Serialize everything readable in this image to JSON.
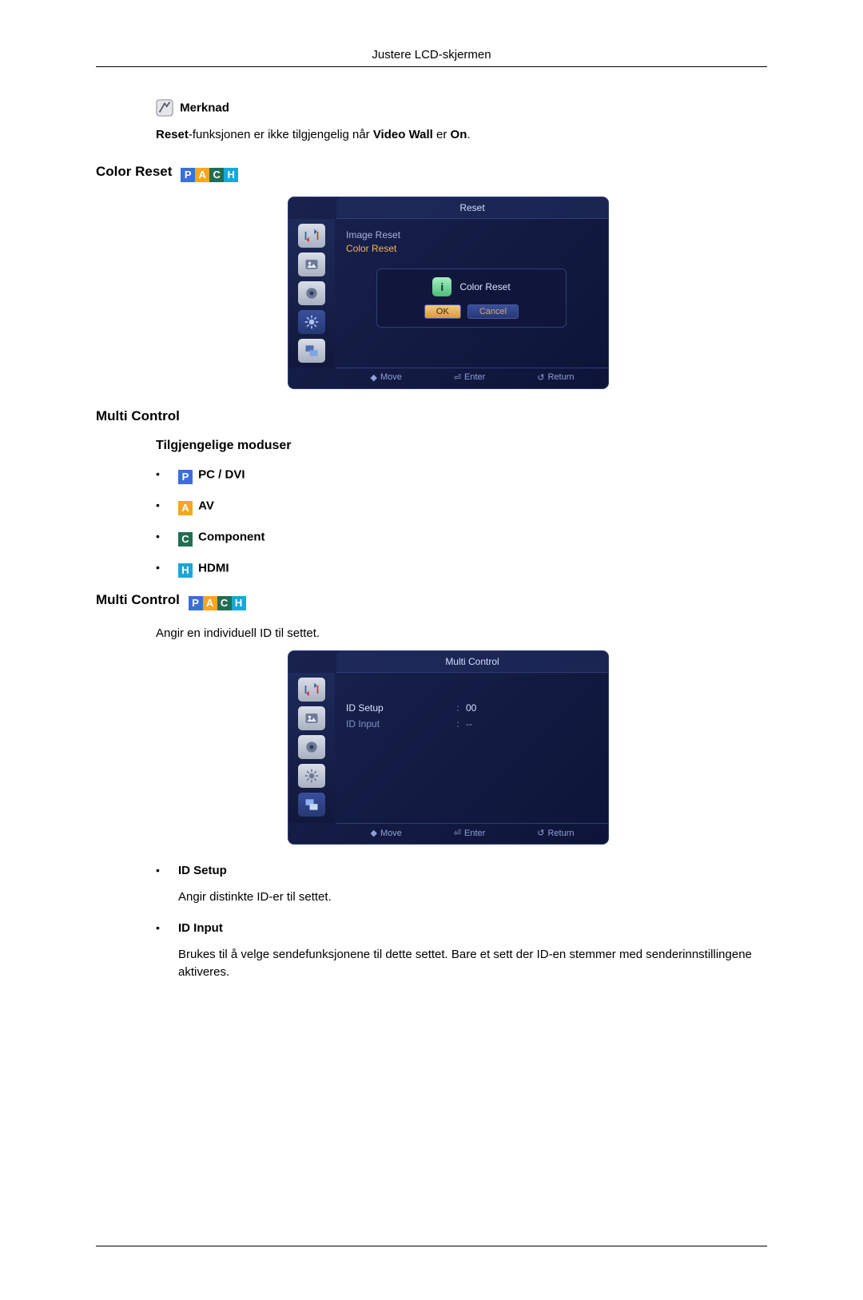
{
  "header": {
    "title": "Justere LCD-skjermen"
  },
  "note": {
    "label": "Merknad",
    "text_before": "Reset",
    "text_mid": "-funksjonen er ikke tilgjengelig når ",
    "text_strong2": "Video Wall",
    "text_mid2": " er ",
    "text_strong3": "On",
    "text_after": "."
  },
  "section_color_reset": {
    "title": "Color Reset",
    "pach": [
      "P",
      "A",
      "C",
      "H"
    ]
  },
  "osd1": {
    "title": "Reset",
    "menu": {
      "image_reset": "Image Reset",
      "color_reset": "Color Reset"
    },
    "dialog": {
      "label": "Color Reset",
      "ok": "OK",
      "cancel": "Cancel"
    },
    "footer": {
      "move": "Move",
      "enter": "Enter",
      "return": "Return"
    }
  },
  "section_multi_control": {
    "title": "Multi Control"
  },
  "modes": {
    "heading": "Tilgjengelige moduser",
    "items": [
      {
        "letter": "P",
        "label": "PC / DVI",
        "cls": "p"
      },
      {
        "letter": "A",
        "label": "AV",
        "cls": "a"
      },
      {
        "letter": "C",
        "label": "Component",
        "cls": "c"
      },
      {
        "letter": "H",
        "label": "HDMI",
        "cls": "h"
      }
    ]
  },
  "section_multi_control2": {
    "title": "Multi Control",
    "pach": [
      "P",
      "A",
      "C",
      "H"
    ],
    "intro": "Angir en individuell ID til settet."
  },
  "osd2": {
    "title": "Multi Control",
    "rows": {
      "id_setup": {
        "k": "ID Setup",
        "v": "00"
      },
      "id_input": {
        "k": "ID Input",
        "v": "--"
      }
    },
    "footer": {
      "move": "Move",
      "enter": "Enter",
      "return": "Return"
    }
  },
  "id_items": {
    "setup": {
      "label": "ID Setup",
      "desc": "Angir distinkte ID-er til settet."
    },
    "input": {
      "label": "ID Input",
      "desc": "Brukes til å velge sendefunksjonene til dette settet. Bare et sett der ID-en stemmer med senderinnstillingene aktiveres."
    }
  }
}
